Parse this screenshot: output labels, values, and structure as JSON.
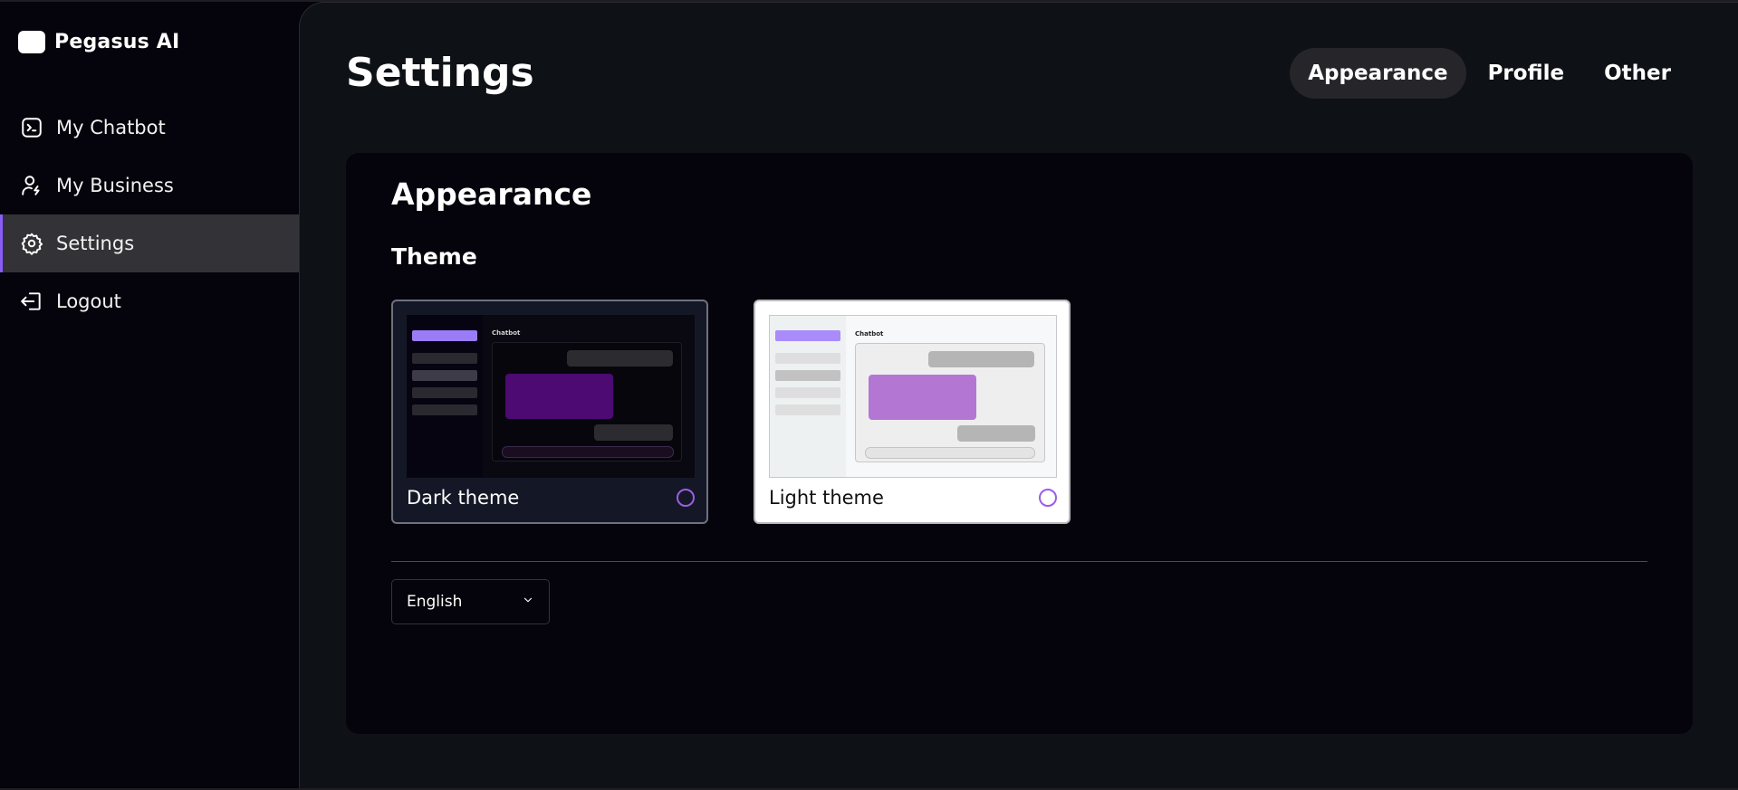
{
  "app": {
    "name": "Pegasus AI"
  },
  "sidebar": {
    "items": [
      {
        "label": "My Chatbot",
        "icon": "terminal-icon"
      },
      {
        "label": "My Business",
        "icon": "user-bolt-icon"
      },
      {
        "label": "Settings",
        "icon": "gear-icon",
        "active": true
      },
      {
        "label": "Logout",
        "icon": "logout-icon"
      }
    ]
  },
  "header": {
    "title": "Settings",
    "tabs": [
      {
        "label": "Appearance",
        "active": true
      },
      {
        "label": "Profile"
      },
      {
        "label": "Other"
      }
    ]
  },
  "appearance": {
    "title": "Appearance",
    "theme_section": "Theme",
    "themes": [
      {
        "label": "Dark theme",
        "preview_title": "Chatbot",
        "selected": false
      },
      {
        "label": "Light theme",
        "preview_title": "Chatbot",
        "selected": false
      }
    ],
    "language": {
      "value": "English"
    }
  },
  "colors": {
    "accent": "#8b5cf6",
    "sidebar_bg": "#05030b",
    "main_bg": "#0e1115",
    "panel_bg": "#05030b",
    "active_nav_bg": "#333236"
  }
}
